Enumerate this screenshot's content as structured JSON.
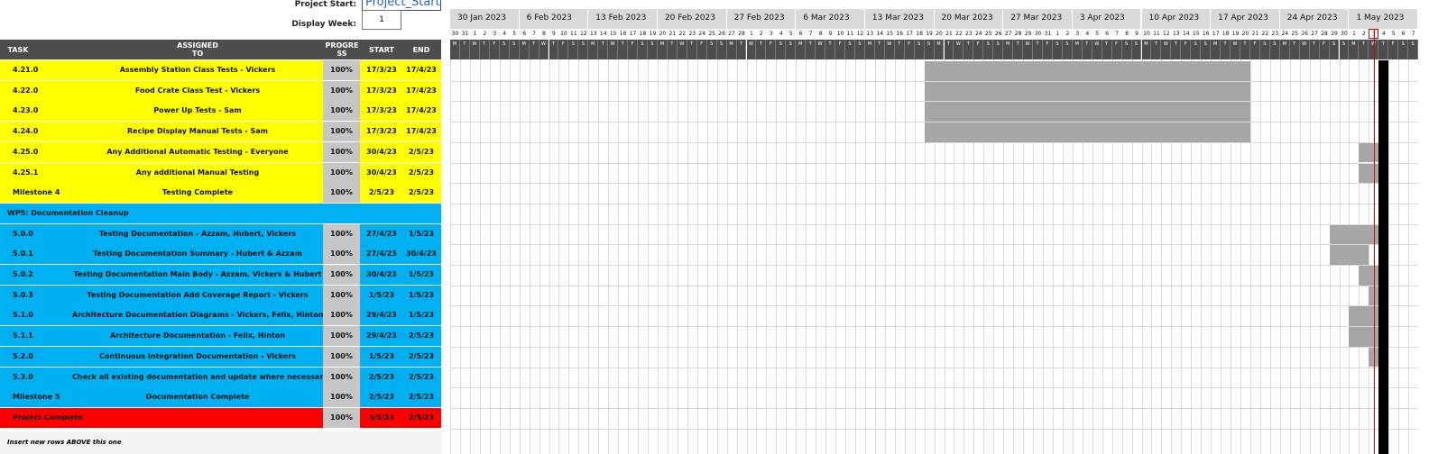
{
  "controls": {
    "project_start_label": "Project Start:",
    "project_start_value": "Project_Start",
    "display_week_label": "Display Week:",
    "display_week_value": "1"
  },
  "table_header": {
    "task": "TASK",
    "assigned": "ASSIGNED TO",
    "progress": "PROGRE SS",
    "start": "START",
    "end": "END"
  },
  "colors": {
    "yellow": "#ffff00",
    "blue": "#00b0f0",
    "red": "#ff0000",
    "header": "#4d4d4d",
    "bar": "#a6a6a6",
    "today_line": "#e00000"
  },
  "rows": [
    {
      "task": "4.21.0",
      "assigned": "Assembly Station Class Tests - Vickers",
      "progress": "100%",
      "start": "17/3/23",
      "end": "17/4/23",
      "color": "yellow",
      "bar": [
        48,
        81
      ]
    },
    {
      "task": "4.22.0",
      "assigned": "Food Crate Class Test - Vickers",
      "progress": "100%",
      "start": "17/3/23",
      "end": "17/4/23",
      "color": "yellow",
      "bar": [
        48,
        81
      ]
    },
    {
      "task": "4.23.0",
      "assigned": "Power Up Tests - Sam",
      "progress": "100%",
      "start": "17/3/23",
      "end": "17/4/23",
      "color": "yellow",
      "bar": [
        48,
        81
      ]
    },
    {
      "task": "4.24.0",
      "assigned": "Recipe Display Manual Tests - Sam",
      "progress": "100%",
      "start": "17/3/23",
      "end": "17/4/23",
      "color": "yellow",
      "bar": [
        48,
        81
      ]
    },
    {
      "task": "4.25.0",
      "assigned": "Any Additional Automatic Testing - Everyone",
      "progress": "100%",
      "start": "30/4/23",
      "end": "2/5/23",
      "color": "yellow",
      "bar": [
        92,
        95
      ]
    },
    {
      "task": "4.25.1",
      "assigned": "Any additional Manual Testing",
      "progress": "100%",
      "start": "30/4/23",
      "end": "2/5/23",
      "color": "yellow",
      "bar": [
        92,
        95
      ]
    },
    {
      "task": "Milestone 4",
      "assigned": "Testing Complete",
      "progress": "100%",
      "start": "2/5/23",
      "end": "2/5/23",
      "color": "yellow",
      "bar": [
        94,
        95
      ]
    },
    {
      "task": "WP5: Documentation Cleanup",
      "assigned": "",
      "progress": "",
      "start": "",
      "end": "",
      "color": "blue",
      "section": true
    },
    {
      "task": "5.0.0",
      "assigned": "Testing Documentation - Azzam, Hubert, Vickers",
      "progress": "100%",
      "start": "27/4/23",
      "end": "1/5/23",
      "color": "blue",
      "bar": [
        89,
        94
      ]
    },
    {
      "task": "5.0.1",
      "assigned": "Testing Documentation Summary - Hubert & Azzam",
      "progress": "100%",
      "start": "27/4/23",
      "end": "30/4/23",
      "color": "blue",
      "bar": [
        89,
        93
      ]
    },
    {
      "task": "5.0.2",
      "assigned": "Testing Documentation Main Body - Azzam, Vickers & Hubert",
      "progress": "100%",
      "start": "30/4/23",
      "end": "1/5/23",
      "color": "blue",
      "bar": [
        92,
        94
      ]
    },
    {
      "task": "5.0.3",
      "assigned": "Testing Documentation Add Coverage Report - Vickers",
      "progress": "100%",
      "start": "1/5/23",
      "end": "1/5/23",
      "color": "blue",
      "bar": [
        93,
        94
      ]
    },
    {
      "task": "5.1.0",
      "assigned": "Architecture Documentation Diagrams - Vickers, Felix, Hinton",
      "progress": "100%",
      "start": "29/4/23",
      "end": "1/5/23",
      "color": "blue",
      "bar": [
        91,
        94
      ]
    },
    {
      "task": "5.1.1",
      "assigned": "Architecture Documentation - Felix, Hinton",
      "progress": "100%",
      "start": "29/4/23",
      "end": "2/5/23",
      "color": "blue",
      "bar": [
        91,
        95
      ]
    },
    {
      "task": "5.2.0",
      "assigned": "Continuous Integration Documentation - Vickers",
      "progress": "100%",
      "start": "1/5/23",
      "end": "2/5/23",
      "color": "blue",
      "bar": [
        93,
        95
      ]
    },
    {
      "task": "5.3.0",
      "assigned": "Check all existing documentation and update where necessary - Everyone",
      "progress": "100%",
      "start": "2/5/23",
      "end": "2/5/23",
      "color": "blue",
      "bar": [
        94,
        95
      ]
    },
    {
      "task": "Milestone 5",
      "assigned": "Documentation Complete",
      "progress": "100%",
      "start": "2/5/23",
      "end": "2/5/23",
      "color": "blue",
      "bar": [
        94,
        95
      ]
    },
    {
      "task": "Project Complete",
      "assigned": "",
      "progress": "100%",
      "start": "3/5/23",
      "end": "2/5/23",
      "color": "red",
      "bar": [
        94,
        95
      ]
    }
  ],
  "footer_note": "Insert new rows ABOVE this one",
  "weeks": [
    "30 Jan 2023",
    "6 Feb 2023",
    "13 Feb 2023",
    "20 Feb 2023",
    "27 Feb 2023",
    "6 Mar 2023",
    "13 Mar 2023",
    "20 Mar 2023",
    "27 Mar 2023",
    "3 Apr 2023",
    "10 Apr 2023",
    "17 Apr 2023",
    "24 Apr 2023",
    "1 May 2023"
  ],
  "day_numbers": [
    "30",
    "31",
    "1",
    "2",
    "3",
    "4",
    "5",
    "6",
    "7",
    "8",
    "9",
    "10",
    "11",
    "12",
    "13",
    "14",
    "15",
    "16",
    "17",
    "18",
    "19",
    "20",
    "21",
    "22",
    "23",
    "24",
    "25",
    "26",
    "27",
    "28",
    "1",
    "2",
    "3",
    "4",
    "5",
    "6",
    "7",
    "8",
    "9",
    "10",
    "11",
    "12",
    "13",
    "14",
    "15",
    "16",
    "17",
    "18",
    "19",
    "20",
    "21",
    "22",
    "23",
    "24",
    "25",
    "26",
    "27",
    "28",
    "29",
    "30",
    "31",
    "1",
    "2",
    "3",
    "4",
    "5",
    "6",
    "7",
    "8",
    "9",
    "10",
    "11",
    "12",
    "13",
    "14",
    "15",
    "16",
    "17",
    "18",
    "19",
    "20",
    "21",
    "22",
    "23",
    "24",
    "25",
    "26",
    "27",
    "28",
    "29",
    "30",
    "1",
    "2",
    "3",
    "4",
    "5",
    "6",
    "7"
  ],
  "day_letters": [
    "M",
    "T",
    "W",
    "T",
    "F",
    "S",
    "S"
  ],
  "today_day_index": 93
}
